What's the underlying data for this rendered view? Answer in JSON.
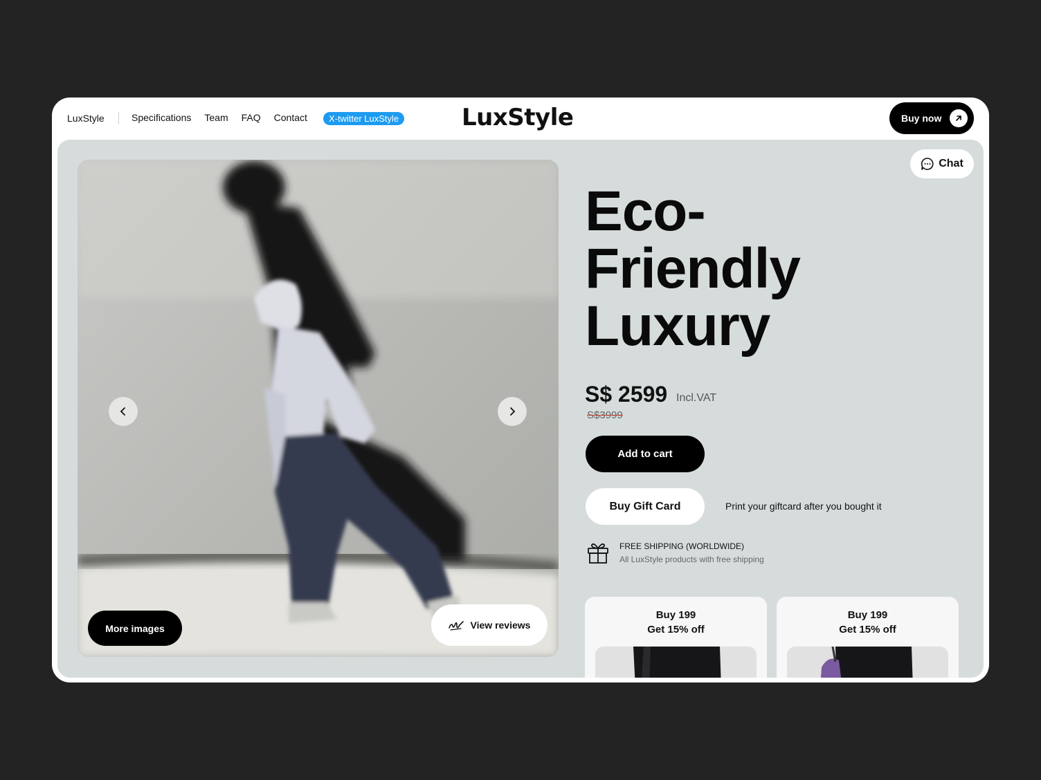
{
  "header": {
    "brand_small": "LuxStyle",
    "nav": [
      "Specifications",
      "Team",
      "FAQ",
      "Contact"
    ],
    "social_badge": "X-twitter LuxStyle",
    "logo": "LuxStyle",
    "buy_now": "Buy now"
  },
  "gallery": {
    "more_images": "More images",
    "view_reviews": "View reviews"
  },
  "chat": {
    "label": "Chat"
  },
  "product": {
    "headline": [
      "Eco-",
      "Friendly",
      "Luxury"
    ],
    "price": "S$ 2599",
    "vat": "Incl.VAT",
    "old_price": "S$3999",
    "add_to_cart": "Add to cart",
    "buy_gift_card": "Buy Gift Card",
    "gift_note": "Print your giftcard after you bought it",
    "shipping_title": "FREE SHIPPING (WORLDWIDE)",
    "shipping_sub": "All LuxStyle products with free shipping"
  },
  "promos": [
    {
      "line1": "Buy 199",
      "line2": "Get 15% off"
    },
    {
      "line1": "Buy 199",
      "line2": "Get 15% off"
    }
  ],
  "colors": {
    "page_bg": "#232323",
    "panel_bg": "#d6dcdc",
    "accent_twitter": "#1d9bf0",
    "primary_button": "#000000"
  }
}
